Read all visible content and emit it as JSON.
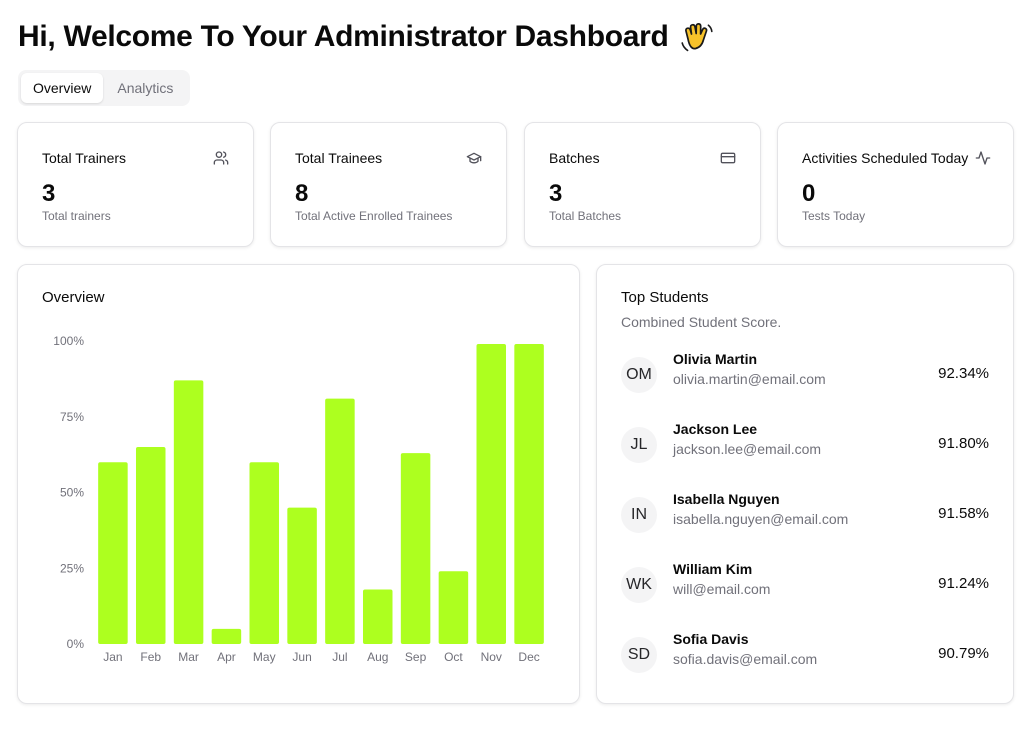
{
  "header": {
    "title": "Hi, Welcome To Your Administrator Dashboard",
    "emoji_icon": "waving-hand-icon"
  },
  "tabs": [
    {
      "label": "Overview",
      "active": true
    },
    {
      "label": "Analytics",
      "active": false
    }
  ],
  "stats": [
    {
      "title": "Total Trainers",
      "value": "3",
      "subtitle": "Total trainers",
      "icon": "users-icon"
    },
    {
      "title": "Total Trainees",
      "value": "8",
      "subtitle": "Total Active Enrolled Trainees",
      "icon": "graduation-cap-icon"
    },
    {
      "title": "Batches",
      "value": "3",
      "subtitle": "Total Batches",
      "icon": "credit-card-icon"
    },
    {
      "title": "Activities Scheduled Today",
      "value": "0",
      "subtitle": "Tests Today",
      "icon": "activity-icon"
    }
  ],
  "overview": {
    "title": "Overview"
  },
  "chart_data": {
    "type": "bar",
    "categories": [
      "Jan",
      "Feb",
      "Mar",
      "Apr",
      "May",
      "Jun",
      "Jul",
      "Aug",
      "Sep",
      "Oct",
      "Nov",
      "Dec"
    ],
    "values": [
      60,
      65,
      87,
      5,
      60,
      45,
      81,
      18,
      63,
      24,
      99,
      99
    ],
    "ylim": [
      0,
      100
    ],
    "yticks": [
      "0%",
      "25%",
      "50%",
      "75%",
      "100%"
    ],
    "ytick_values": [
      0,
      25,
      50,
      75,
      100
    ],
    "bar_color": "#adff1f",
    "grid": false
  },
  "top_students": {
    "title": "Top Students",
    "subtitle": "Combined Student Score.",
    "items": [
      {
        "initials": "OM",
        "name": "Olivia Martin",
        "email": "olivia.martin@email.com",
        "score": "92.34%"
      },
      {
        "initials": "JL",
        "name": "Jackson Lee",
        "email": "jackson.lee@email.com",
        "score": "91.80%"
      },
      {
        "initials": "IN",
        "name": "Isabella Nguyen",
        "email": "isabella.nguyen@email.com",
        "score": "91.58%"
      },
      {
        "initials": "WK",
        "name": "William Kim",
        "email": "will@email.com",
        "score": "91.24%"
      },
      {
        "initials": "SD",
        "name": "Sofia Davis",
        "email": "sofia.davis@email.com",
        "score": "90.79%"
      }
    ]
  }
}
